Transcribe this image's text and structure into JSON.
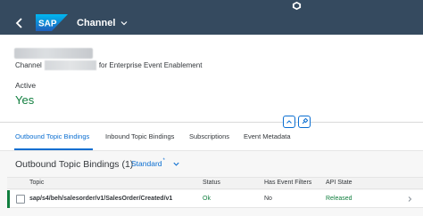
{
  "shell": {
    "brand": "SAP",
    "app_title": "Channel",
    "icons": {
      "back": "back-arrow-icon",
      "title_menu": "chevron-down-icon",
      "top": "sap-box-icon"
    }
  },
  "header": {
    "subtitle_prefix": "Channel",
    "subtitle_suffix": "for Enterprise Event Enablement",
    "state_label": "Active",
    "state_value": "Yes"
  },
  "tabs": [
    {
      "label": "Outbound Topic Bindings",
      "active": true
    },
    {
      "label": "Inbound Topic Bindings",
      "active": false
    },
    {
      "label": "Subscriptions",
      "active": false
    },
    {
      "label": "Event Metadata",
      "active": false
    }
  ],
  "section": {
    "title": "Outbound Topic Bindings (1)",
    "variant": "Standard",
    "variant_modified": "*"
  },
  "table": {
    "columns": [
      "Topic",
      "Status",
      "Has Event Filters",
      "API State"
    ],
    "rows": [
      {
        "topic": "sap/s4/beh/salesorder/v1/SalesOrder/Created/v1",
        "status": "Ok",
        "has_event_filters": "No",
        "api_state": "Released"
      }
    ]
  },
  "colors": {
    "shell": "#354a5f",
    "accent": "#0a6ed1",
    "positive": "#107e3e",
    "text": "#32363a"
  }
}
